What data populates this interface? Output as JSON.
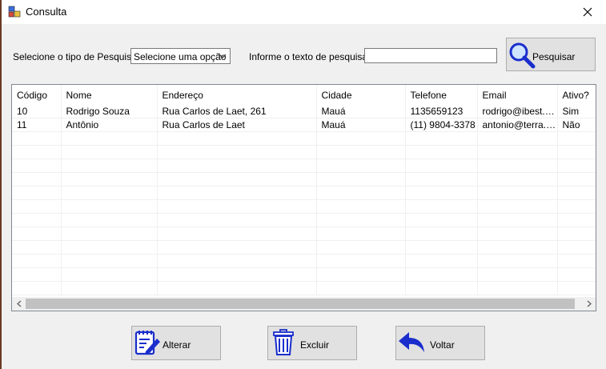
{
  "window": {
    "title": "Consulta"
  },
  "search": {
    "type_label": "Selecione o tipo de Pesquisa:",
    "type_selected": "Selecione uma opção",
    "text_label": "Informe o texto de pesquisa:",
    "text_value": "",
    "button_label": "Pesquisar"
  },
  "grid": {
    "columns": [
      "Código",
      "Nome",
      "Endereço",
      "Cidade",
      "Telefone",
      "Email",
      "Ativo?"
    ],
    "rows": [
      [
        "10",
        "Rodrigo Souza",
        "Rua Carlos de Laet, 261",
        "Mauá",
        "1135659123",
        "rodrigo@ibest.c...",
        "Sim"
      ],
      [
        "11",
        "Antônio",
        "Rua Carlos de Laet",
        "Mauá",
        "(11) 9804-3378",
        "antonio@terra.c...",
        "Não"
      ]
    ]
  },
  "actions": {
    "edit_label": "Alterar",
    "delete_label": "Excluir",
    "back_label": "Voltar"
  },
  "colors": {
    "icon_blue": "#1a2ecc"
  }
}
